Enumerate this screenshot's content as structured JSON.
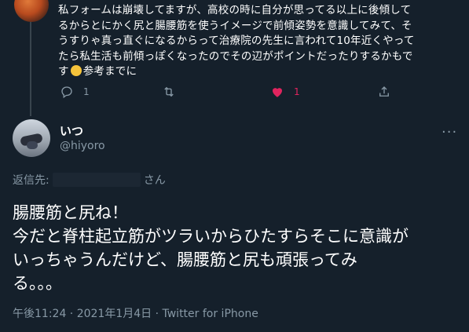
{
  "previous_tweet": {
    "text_lines": [
      "私フォームは崩壊してますが、高校の時に自分が思ってる以上に後傾して",
      "るからとにかく尻と腸腰筋を使うイメージで前傾姿勢を意識してみて、そ",
      "うすりゃ真っ直ぐになるからって治療院の先生に言われて10年近くやって",
      "たら私生活も前傾っぽくなったのでその辺がポイントだったりするかもで",
      "す"
    ],
    "text_tail": "参考までに",
    "emoji": "thinking-face-emoji",
    "actions": {
      "reply_count": "1",
      "retweet_count": "",
      "like_count": "1"
    }
  },
  "tweet": {
    "display_name": "いつ",
    "handle": "@hiyoro",
    "reply_prefix": "返信先:",
    "reply_suffix": "さん",
    "text_lines": [
      "腸腰筋と尻ね！",
      "今だと脊柱起立筋がツラいからひたすらそこに意識が",
      "いっちゃうんだけど、腸腰筋と尻も頑張ってみ",
      "る。。。"
    ],
    "meta": "午後11:24 · 2021年1月4日 · Twitter for iPhone"
  },
  "colors": {
    "background": "#15202b",
    "secondary_text": "#8899a6",
    "like": "#e0245e",
    "thread_line": "#38444d"
  }
}
